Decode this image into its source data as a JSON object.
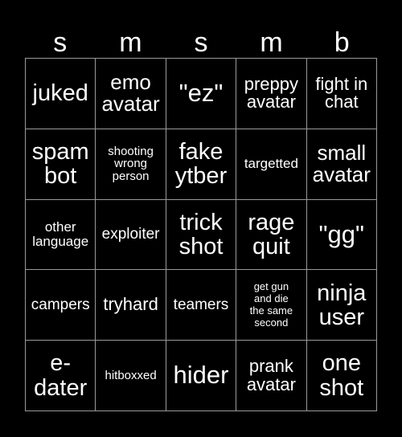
{
  "card": {
    "background_color": "#000000",
    "text_color": "#ffffff",
    "grid_line_color": "#9a9a9a"
  },
  "header": {
    "letters": [
      "s",
      "m",
      "s",
      "m",
      "b"
    ]
  },
  "grid": {
    "columns": 5,
    "rows": 5,
    "cells": [
      {
        "text": "juked",
        "size": "fs-xl"
      },
      {
        "text": "emo\navatar",
        "size": "fs-l"
      },
      {
        "text": "\"ez\"",
        "size": "fs-xxl"
      },
      {
        "text": "preppy\navatar",
        "size": "fs-m"
      },
      {
        "text": "fight in\nchat",
        "size": "fs-m"
      },
      {
        "text": "spam\nbot",
        "size": "fs-xl"
      },
      {
        "text": "shooting\nwrong\nperson",
        "size": "fs-xxs"
      },
      {
        "text": "fake\nytber",
        "size": "fs-xl"
      },
      {
        "text": "targetted",
        "size": "fs-xs"
      },
      {
        "text": "small\navatar",
        "size": "fs-l"
      },
      {
        "text": "other\nlanguage",
        "size": "fs-xs"
      },
      {
        "text": "exploiter",
        "size": "fs-s"
      },
      {
        "text": "trick\nshot",
        "size": "fs-xl"
      },
      {
        "text": "rage\nquit",
        "size": "fs-xl"
      },
      {
        "text": "\"gg\"",
        "size": "fs-xxl"
      },
      {
        "text": "campers",
        "size": "fs-s"
      },
      {
        "text": "tryhard",
        "size": "fs-m"
      },
      {
        "text": "teamers",
        "size": "fs-s"
      },
      {
        "text": "get gun\nand die\nthe same\nsecond",
        "size": "fs-tiny"
      },
      {
        "text": "ninja\nuser",
        "size": "fs-xl"
      },
      {
        "text": "e-\ndater",
        "size": "fs-xl"
      },
      {
        "text": "hitboxxed",
        "size": "fs-xxs"
      },
      {
        "text": "hider",
        "size": "fs-xxl"
      },
      {
        "text": "prank\navatar",
        "size": "fs-m"
      },
      {
        "text": "one\nshot",
        "size": "fs-xl"
      }
    ]
  }
}
